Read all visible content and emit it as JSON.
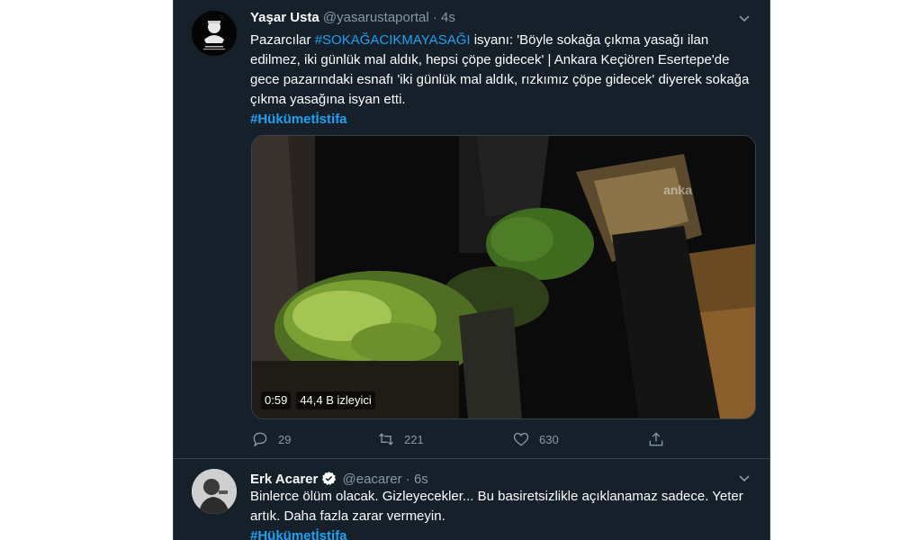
{
  "tweets": [
    {
      "author_name": "Yaşar Usta",
      "handle": "@yasarustaportal",
      "separator": "·",
      "time": "4s",
      "text_intro": "Pazarcılar ",
      "text_hashtag": "#SOKAĞACIKMAYASAĞI",
      "text_body": " isyanı: 'Böyle sokağa çıkma yasağı ilan edilmez, iki günlük mal aldık, hepsi çöpe gidecek' | Ankara Keçiören Esertepe'de gece pazarındaki esnafı 'iki günlük mal aldık, rızkımız çöpe gidecek' diyerek sokağa çıkma yasağına isyan etti.",
      "hashtag_line": "#Hükümetİstifa",
      "video": {
        "duration": "0:59",
        "views": "44,4 B izleyici",
        "watermark": "anka"
      },
      "replies": "29",
      "retweets": "221",
      "likes": "630"
    },
    {
      "author_name": "Erk Acarer",
      "handle": "@eacarer",
      "separator": "·",
      "time": "6s",
      "text": "Binlerce ölüm olacak. Gizleyecekler... Bu basiretsizlikle açıklanamaz sadece. Yeter artık. Daha fazla zarar vermeyin.",
      "hashtag_line": "#Hükümetİstifa"
    }
  ],
  "colors": {
    "background": "#15202b",
    "border": "#38444d",
    "secondary_text": "#8899a6",
    "accent": "#1da1f2"
  },
  "icons": [
    "chevron-down-icon",
    "reply-icon",
    "retweet-icon",
    "like-icon",
    "share-icon",
    "verified-icon"
  ]
}
